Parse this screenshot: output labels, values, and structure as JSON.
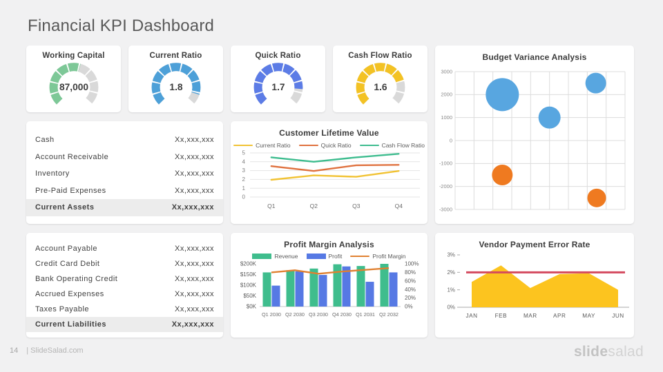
{
  "slide": {
    "title": "Financial KPI Dashboard",
    "page_number": "14",
    "footer_site": "| SlideSalad.com",
    "brand_bold": "slide",
    "brand_light": "salad"
  },
  "kpi_cards": [
    {
      "title": "Working Capital",
      "value": "87,000",
      "fraction": 0.56,
      "color": "#7dc897",
      "track_color": "#d9d9d9"
    },
    {
      "title": "Current Ratio",
      "value": "1.8",
      "fraction": 0.9,
      "color": "#4da0d8",
      "track_color": "#d9d9d9"
    },
    {
      "title": "Quick Ratio",
      "value": "1.7",
      "fraction": 0.85,
      "color": "#5c7ce6",
      "track_color": "#d9d9d9"
    },
    {
      "title": "Cash Flow Ratio",
      "value": "1.6",
      "fraction": 0.78,
      "color": "#f3c224",
      "track_color": "#d9d9d9"
    }
  ],
  "assets_table": {
    "rows": [
      {
        "label": "Cash",
        "value": "Xx,xxx,xxx"
      },
      {
        "label": "Account Receivable",
        "value": "Xx,xxx,xxx"
      },
      {
        "label": "Inventory",
        "value": "Xx,xxx,xxx"
      },
      {
        "label": "Pre-Paid Expenses",
        "value": "Xx,xxx,xxx"
      }
    ],
    "total": {
      "label": "Current Assets",
      "value": "Xx,xxx,xxx"
    }
  },
  "liabilities_table": {
    "rows": [
      {
        "label": "Account Payable",
        "value": "Xx,xxx,xxx"
      },
      {
        "label": "Credit Card Debit",
        "value": "Xx,xxx,xxx"
      },
      {
        "label": "Bank Operating Credit",
        "value": "Xx,xxx,xxx"
      },
      {
        "label": "Accrued Expenses",
        "value": "Xx,xxx,xxx"
      },
      {
        "label": "Taxes Payable",
        "value": "Xx,xxx,xxx"
      }
    ],
    "total": {
      "label": "Current Liabilities",
      "value": "Xx,xxx,xxx"
    }
  },
  "chart_data": [
    {
      "id": "customer-lifetime-value",
      "type": "line",
      "title": "Customer Lifetime  Value",
      "categories": [
        "Q1",
        "Q2",
        "Q3",
        "Q4"
      ],
      "series": [
        {
          "name": "Current Ratio",
          "color": "#f1c232",
          "values": [
            1.95,
            2.45,
            2.3,
            2.95
          ]
        },
        {
          "name": "Quick Ratio",
          "color": "#df703d",
          "values": [
            3.5,
            2.95,
            3.6,
            3.65
          ]
        },
        {
          "name": "Cash Flow Ratio",
          "color": "#3dbc8e",
          "values": [
            4.5,
            4.0,
            4.5,
            4.9
          ]
        }
      ],
      "ylim": [
        0,
        5
      ],
      "yticks": [
        0,
        1,
        2,
        3,
        4,
        5
      ],
      "legend_position": "top",
      "grid": "horizontal"
    },
    {
      "id": "budget-variance-analysis",
      "type": "scatter",
      "title": "Budget Variance Analysis",
      "xlim": [
        0,
        9
      ],
      "ylim": [
        -3000,
        3000
      ],
      "yticks": [
        3000,
        2000,
        1000,
        0,
        -1000,
        -2000,
        -3000
      ],
      "x_gridlines": 9,
      "grid": "both",
      "bubbles": [
        {
          "x": 2.5,
          "y": 2000,
          "r": 24,
          "color": "#58a6e0"
        },
        {
          "x": 5.0,
          "y": 1000,
          "r": 16,
          "color": "#58a6e0"
        },
        {
          "x": 7.45,
          "y": 2500,
          "r": 15,
          "color": "#58a6e0"
        },
        {
          "x": 2.5,
          "y": -1500,
          "r": 15,
          "color": "#ef7a20"
        },
        {
          "x": 7.5,
          "y": -2500,
          "r": 13.5,
          "color": "#ef7a20"
        }
      ]
    },
    {
      "id": "profit-margin-analysis",
      "type": "bar",
      "title": "Profit Margin Analysis",
      "categories": [
        "Q1 2030",
        "Q2 2030",
        "Q3 2030",
        "Q4 2030",
        "Q1 2031",
        "Q2 2032"
      ],
      "series": [
        {
          "name": "Revenue",
          "kind": "bar",
          "color": "#3fbd8d",
          "axis": "left",
          "values": [
            160,
            170,
            178,
            198,
            190,
            200
          ]
        },
        {
          "name": "Profit",
          "kind": "bar",
          "color": "#5679e4",
          "axis": "left",
          "values": [
            98,
            165,
            148,
            188,
            116,
            160
          ]
        },
        {
          "name": "Profit Margin",
          "kind": "line",
          "color": "#e08030",
          "axis": "right",
          "values": [
            80,
            85,
            77,
            82,
            86,
            90
          ]
        }
      ],
      "ylim_left": [
        0,
        200
      ],
      "yticks_left": [
        {
          "v": 0,
          "label": "$0K"
        },
        {
          "v": 50,
          "label": "$50K"
        },
        {
          "v": 100,
          "label": "$100K"
        },
        {
          "v": 150,
          "label": "$150K"
        },
        {
          "v": 200,
          "label": "$200K"
        }
      ],
      "ylim_right": [
        0,
        100
      ],
      "yticks_right": [
        {
          "v": 0,
          "label": "0%"
        },
        {
          "v": 20,
          "label": "20%"
        },
        {
          "v": 40,
          "label": "40%"
        },
        {
          "v": 60,
          "label": "60%"
        },
        {
          "v": 80,
          "label": "80%"
        },
        {
          "v": 100,
          "label": "100%"
        }
      ],
      "legend_position": "top",
      "grid": "off"
    },
    {
      "id": "vendor-payment-error-rate",
      "type": "area",
      "title": "Vendor Payment  Error Rate",
      "categories": [
        "JAN",
        "FEB",
        "MAR",
        "APR",
        "MAY",
        "JUN"
      ],
      "values": [
        1.45,
        2.4,
        1.1,
        1.9,
        1.95,
        1.0
      ],
      "area_color": "#fcc41f",
      "target_line": {
        "value": 2,
        "color": "#d44a5e"
      },
      "ylim": [
        0,
        3
      ],
      "yticks": [
        {
          "v": 3,
          "label": "3%"
        },
        {
          "v": 2,
          "label": "2%"
        },
        {
          "v": 1,
          "label": "1%"
        },
        {
          "v": 0,
          "label": "0%"
        }
      ],
      "grid": "off"
    }
  ]
}
